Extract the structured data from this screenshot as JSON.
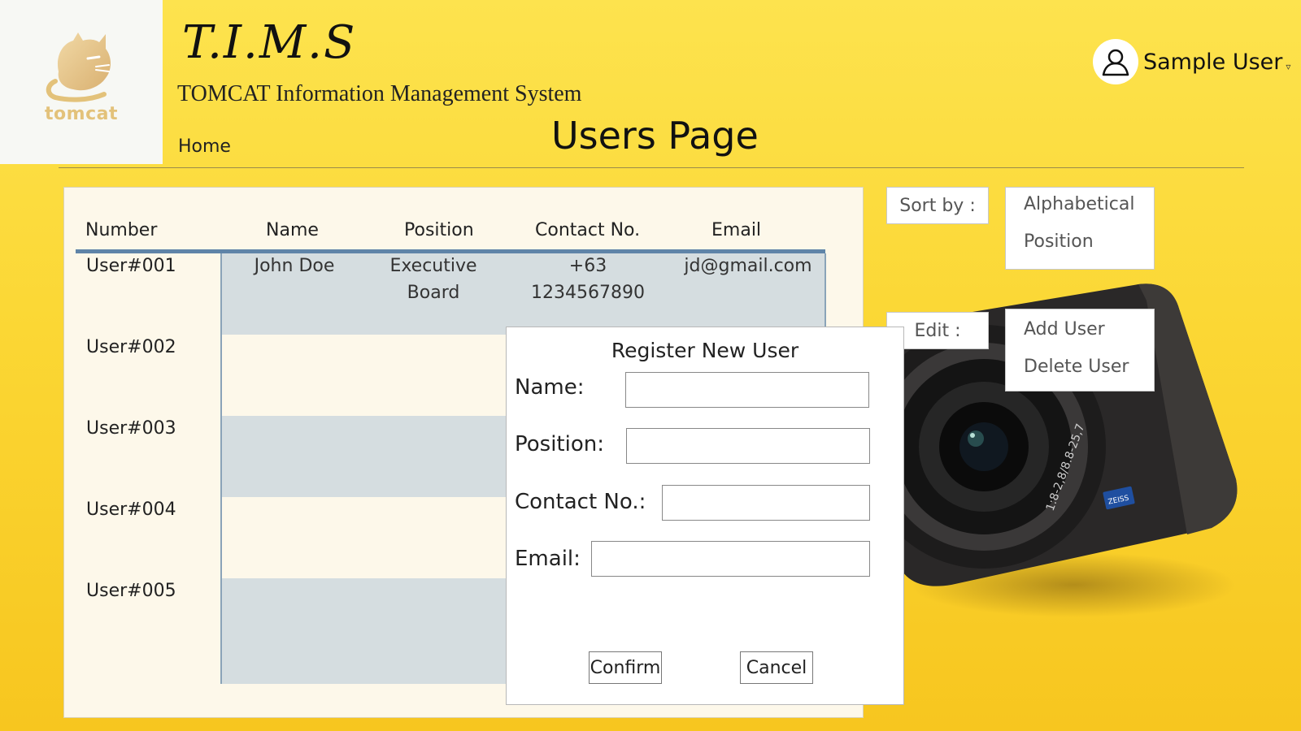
{
  "brand": {
    "logo_text": "tomcat",
    "title": "T.I.M.S",
    "subtitle": "TOMCAT Information Management System"
  },
  "nav": {
    "home": "Home"
  },
  "page": {
    "title": "Users Page"
  },
  "user_menu": {
    "name": "Sample User",
    "icon": "user-icon",
    "caret": "▿"
  },
  "table": {
    "headers": [
      "Number",
      "Name",
      "Position",
      "Contact No.",
      "Email"
    ],
    "rows": [
      {
        "number": "User#001",
        "name": "John Doe",
        "position_line1": "Executive",
        "position_line2": "Board",
        "contact_line1": "+63",
        "contact_line2": "1234567890",
        "email": "jd@gmail.com"
      },
      {
        "number": "User#002"
      },
      {
        "number": "User#003"
      },
      {
        "number": "User#004"
      },
      {
        "number": "User#005"
      }
    ]
  },
  "sort": {
    "label": "Sort by :",
    "options": [
      "Alphabetical",
      "Position"
    ]
  },
  "edit": {
    "label": "Edit :",
    "options": [
      "Add User",
      "Delete User"
    ]
  },
  "dialog": {
    "title": "Register New User",
    "name_label": "Name:",
    "position_label": "Position:",
    "contact_label": "Contact No.:",
    "email_label": "Email:",
    "name_value": "",
    "position_value": "",
    "contact_value": "",
    "email_value": "",
    "confirm": "Confirm",
    "cancel": "Cancel"
  },
  "colors": {
    "background": "#fbd734",
    "table_header_rule": "#5f84a8",
    "row_band": "#d5dde0",
    "logo_gold": "#e3c27a"
  }
}
